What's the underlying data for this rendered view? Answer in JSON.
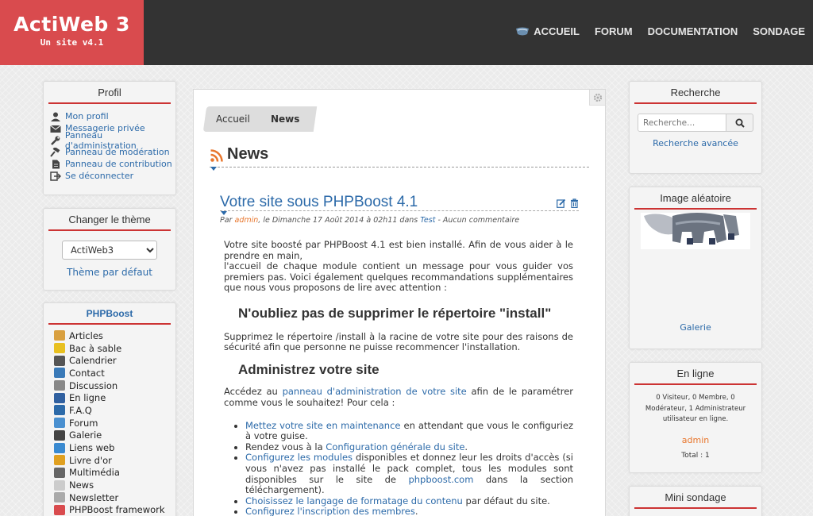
{
  "header": {
    "site_title": "ActiWeb 3",
    "site_subtitle": "Un site v4.1",
    "nav": [
      "ACCUEIL",
      "FORUM",
      "DOCUMENTATION",
      "SONDAGE"
    ]
  },
  "profil": {
    "title": "Profil",
    "items": [
      {
        "label": "Mon profil",
        "icon": "user-icon"
      },
      {
        "label": "Messagerie privée",
        "icon": "envelope-icon"
      },
      {
        "label": "Panneau d'administration",
        "icon": "wrench-icon"
      },
      {
        "label": "Panneau de modération",
        "icon": "gavel-icon"
      },
      {
        "label": "Panneau de contribution",
        "icon": "file-icon"
      },
      {
        "label": "Se déconnecter",
        "icon": "logout-icon"
      }
    ]
  },
  "theme": {
    "title": "Changer le thème",
    "selected": "ActiWeb3",
    "default_link": "Thème par défaut"
  },
  "phpboost": {
    "title": "PHPBoost",
    "modules": [
      {
        "label": "Articles",
        "color": "#d9a040"
      },
      {
        "label": "Bac à sable",
        "color": "#e8c020"
      },
      {
        "label": "Calendrier",
        "color": "#555555"
      },
      {
        "label": "Contact",
        "color": "#3a7ab8"
      },
      {
        "label": "Discussion",
        "color": "#888888"
      },
      {
        "label": "En ligne",
        "color": "#3060a0"
      },
      {
        "label": "F.A.Q",
        "color": "#2c6aa9"
      },
      {
        "label": "Forum",
        "color": "#4a90d0"
      },
      {
        "label": "Galerie",
        "color": "#444444"
      },
      {
        "label": "Liens web",
        "color": "#3a8ad0"
      },
      {
        "label": "Livre d'or",
        "color": "#e0a020"
      },
      {
        "label": "Multimédia",
        "color": "#666666"
      },
      {
        "label": "News",
        "color": "#cccccc"
      },
      {
        "label": "Newsletter",
        "color": "#aaaaaa"
      },
      {
        "label": "PHPBoost framework",
        "color": "#d94b4e"
      }
    ]
  },
  "breadcrumb": {
    "home": "Accueil",
    "current": "News"
  },
  "page_title": "News",
  "article": {
    "title": "Votre site sous PHPBoost 4.1",
    "meta_par": "Par",
    "meta_author": "admin",
    "meta_date": ", le Dimanche 17 Août 2014 à 02h11 dans",
    "meta_cat": "Test",
    "meta_comments": "- Aucun commentaire",
    "intro_1": "Votre site boosté par PHPBoost 4.1 est bien installé. Afin de vous aider à le prendre en main,",
    "intro_2": "l'accueil de chaque module contient un message pour vous guider vos premiers pas. Voici également quelques recommandations supplémentaires que nous vous proposons de lire avec attention :",
    "h_install": "N'oubliez pas de supprimer le répertoire \"install\"",
    "p_install": "Supprimez le répertoire /install à la racine de votre site pour des raisons de sécurité afin que personne ne puisse recommencer l'installation.",
    "h_admin": "Administrez votre site",
    "p_admin_1": "Accédez au",
    "p_admin_link": "panneau d'administration de votre site",
    "p_admin_2": "afin de le paramétrer comme vous le souhaitez! Pour cela :",
    "li1_link": "Mettez votre site en maintenance",
    "li1_text": " en attendant que vous le configuriez à votre guise.",
    "li2_text": "Rendez vous à la ",
    "li2_link": "Configuration générale du site",
    "li2_end": ".",
    "li3_link": "Configurez les modules",
    "li3_text": " disponibles et donnez leur les droits d'accès (si vous n'avez pas installé le pack complet, tous les modules sont disponibles sur le site de ",
    "li3_link2": "phpboost.com",
    "li3_end": " dans la section téléchargement).",
    "li4_link": "Choisissez le langage de formatage du contenu",
    "li4_text": " par défaut du site.",
    "li5_link": "Configurez l'inscription des membres",
    "li5_end": "."
  },
  "search": {
    "title": "Recherche",
    "placeholder": "Recherche...",
    "advanced": "Recherche avancée"
  },
  "random_image": {
    "title": "Image aléatoire",
    "link": "Galerie"
  },
  "online": {
    "title": "En ligne",
    "stats": "0 Visiteur, 0 Membre, 0 Modérateur, 1 Administrateur utilisateur en ligne.",
    "user": "admin",
    "total": "Total : 1"
  },
  "poll": {
    "title": "Mini sondage"
  }
}
